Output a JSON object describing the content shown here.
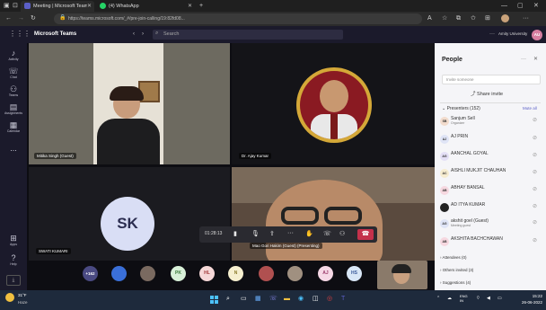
{
  "browser": {
    "tabs": [
      {
        "label": "Meeting | Microsoft Teams",
        "active": true
      },
      {
        "label": "(4) WhatsApp",
        "active": false
      }
    ],
    "url": "https://teams.microsoft.com/_#/pre-join-calling/19:82fd08..."
  },
  "teams": {
    "app_title": "Microsoft Teams",
    "search_placeholder": "Search",
    "user_name": "Amity University",
    "user_initials": "AU"
  },
  "rail": [
    {
      "label": "Activity",
      "icon": "bell-icon"
    },
    {
      "label": "Chat",
      "icon": "chat-icon"
    },
    {
      "label": "Teams",
      "icon": "teams-icon"
    },
    {
      "label": "Assignments",
      "icon": "assignments-icon"
    },
    {
      "label": "Calendar",
      "icon": "calendar-icon"
    },
    {
      "label": "...",
      "icon": "more-icon"
    },
    {
      "label": "Apps",
      "icon": "apps-icon"
    },
    {
      "label": "Help",
      "icon": "help-icon"
    }
  ],
  "tiles": [
    {
      "label": "Mitika Singh (Guest)"
    },
    {
      "label": "Dr. Ajay Kumar"
    },
    {
      "label": "SWATI KUMARI",
      "initials": "SK"
    },
    {
      "label": "Mao Gori Hakim (Guest) (Presenting)"
    }
  ],
  "toolbar": {
    "timer": "01:28:13"
  },
  "strip": [
    {
      "text": "+162",
      "color": "#4a4a82",
      "fg": "#ffffff"
    },
    {
      "text": "PK",
      "color": "#d8f0d8",
      "fg": "#3a7a3a"
    },
    {
      "text": "HL",
      "color": "#f6d8d8",
      "fg": "#a33a3a"
    },
    {
      "text": "N",
      "color": "#f6efcf",
      "fg": "#8a7a2a"
    },
    {
      "text": "AJ",
      "color": "#f6d8e6",
      "fg": "#9a3a6a"
    },
    {
      "text": "HS",
      "color": "#d8e6f6",
      "fg": "#3a5a9a"
    }
  ],
  "people": {
    "title": "People",
    "invite_placeholder": "Invite someone",
    "share_invite": "Share invite",
    "presenters_header": "Presenters (152)",
    "mute_all": "Mute all",
    "presenters": [
      {
        "initials": "SB",
        "name": "Sanjum Sell",
        "sub": "Organizer",
        "color": "#f2dccd"
      },
      {
        "initials": "AJ",
        "name": "AJ PRIN",
        "sub": "",
        "color": "#dfe4f6"
      },
      {
        "initials": "AG",
        "name": "AANCHAL GOYAL",
        "sub": "",
        "color": "#e4dff6"
      },
      {
        "initials": "AC",
        "name": "AISHLI MUKJIT CHAUHAN",
        "sub": "",
        "color": "#f6ecd0"
      },
      {
        "initials": "AB",
        "name": "ABHAY BANSAL",
        "sub": "",
        "color": "#f6d8e0"
      },
      {
        "initials": "AK",
        "name": "AD ITYA KUMAR",
        "sub": "",
        "color": "#222222"
      },
      {
        "initials": "AG",
        "name": "akshit goel (Guest)",
        "sub": "Meeting guest",
        "color": "#dfe4f6"
      },
      {
        "initials": "AB",
        "name": "AKSHITA BACHCHAWAN",
        "sub": "",
        "color": "#f6d8e0"
      }
    ],
    "sections": [
      "Attendees (0)",
      "Others invited (3)",
      "Suggestions (4)"
    ]
  },
  "taskbar": {
    "weather_temp": "31°F",
    "weather_desc": "Haze",
    "lang": "ENG",
    "lang2": "IN",
    "time": "15:22",
    "date": "26-06-2022"
  }
}
